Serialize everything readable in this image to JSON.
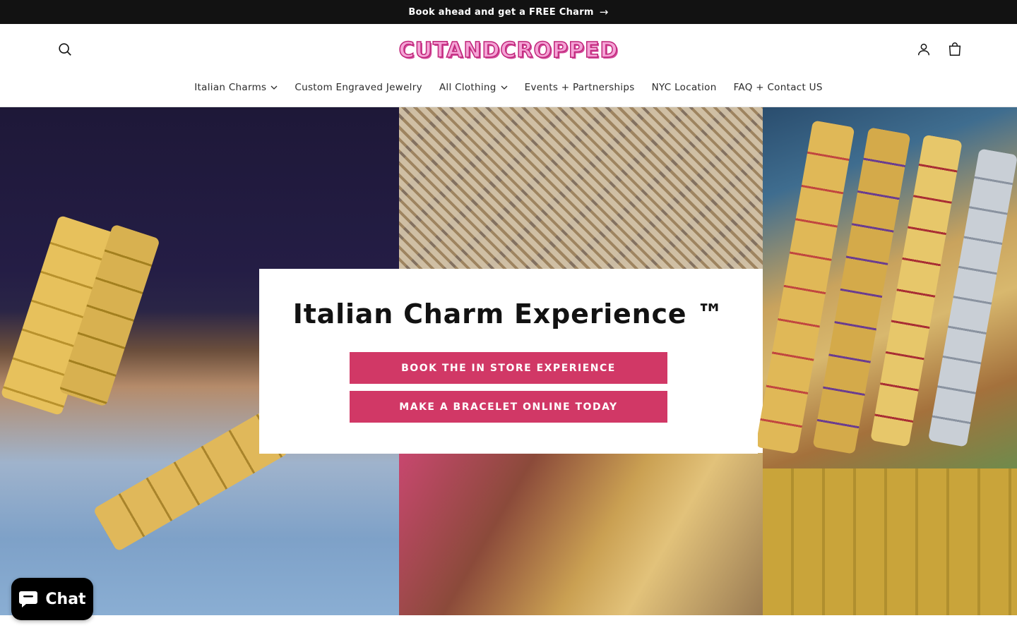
{
  "announcement": {
    "text": "Book ahead and get a FREE Charm",
    "arrow": "→"
  },
  "header": {
    "logo_text": "CUTANDCROPPED"
  },
  "nav": {
    "items": [
      {
        "label": "Italian Charms",
        "has_dropdown": true
      },
      {
        "label": "Custom Engraved Jewelry",
        "has_dropdown": false
      },
      {
        "label": "All Clothing",
        "has_dropdown": true
      },
      {
        "label": "Events + Partnerships",
        "has_dropdown": false
      },
      {
        "label": "NYC Location",
        "has_dropdown": false
      },
      {
        "label": "FAQ + Contact US",
        "has_dropdown": false
      }
    ]
  },
  "hero": {
    "title": "Italian Charm Experience ™",
    "primary_button": "BOOK THE IN STORE EXPERIENCE",
    "secondary_button": "MAKE A BRACELET ONLINE TODAY"
  },
  "chat": {
    "label": "Chat"
  },
  "colors": {
    "accent": "#d13866",
    "announcement_bg": "#121212",
    "logo_pink": "#f5a3d6"
  },
  "icons": [
    "search-icon",
    "account-icon",
    "cart-icon",
    "chevron-down-icon",
    "chat-bubble-icon",
    "arrow-right-icon"
  ]
}
